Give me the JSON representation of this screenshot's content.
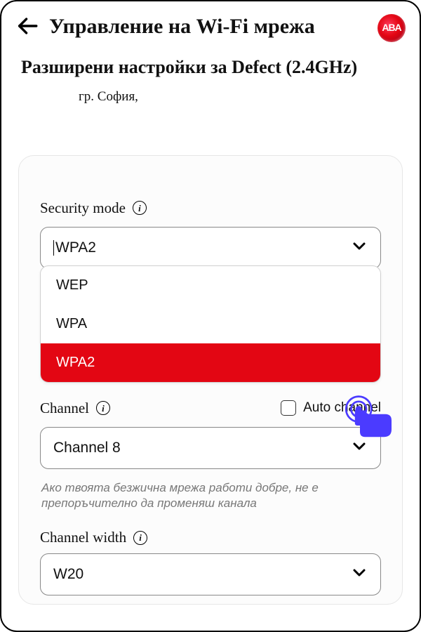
{
  "header": {
    "title": "Управление на Wi-Fi мрежа",
    "brand_text": "ABA"
  },
  "page": {
    "subtitle": "Разширени настройки за Defect (2.4GHz)",
    "location": "гр. София,"
  },
  "security": {
    "label": "Security mode",
    "value": "WPA2",
    "options": [
      "WEP",
      "WPA",
      "WPA2"
    ],
    "selected_index": 2
  },
  "channel": {
    "label": "Channel",
    "auto_label": "Auto channel",
    "auto_checked": false,
    "value": "Channel 8",
    "hint": "Ако твоята безжична мрежа работи добре, не е препоръчително да променяш канала"
  },
  "channel_width": {
    "label": "Channel width",
    "value": "W20"
  },
  "icons": {
    "info_glyph": "i"
  }
}
